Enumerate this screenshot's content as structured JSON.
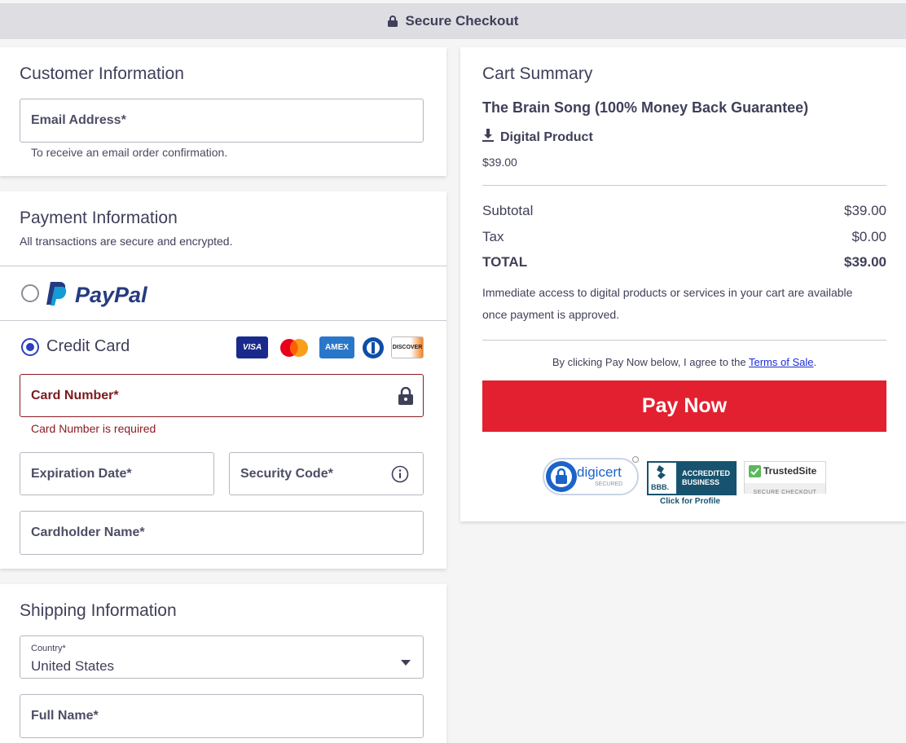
{
  "header": {
    "title": "Secure Checkout",
    "icon": "lock-icon"
  },
  "customer": {
    "title": "Customer Information",
    "email_label": "Email Address*",
    "email_hint": "To receive an email order confirmation."
  },
  "payment": {
    "title": "Payment Information",
    "subtitle": "All transactions are secure and encrypted.",
    "paypal_label": "PayPal",
    "credit_label": "Credit Card",
    "card_logos": [
      "VISA",
      "Mastercard",
      "AMEX",
      "Diners",
      "DISCOVER"
    ],
    "card_number_label": "Card Number*",
    "card_number_error": "Card Number is required",
    "expiration_label": "Expiration Date*",
    "security_label": "Security Code*",
    "cardholder_label": "Cardholder Name*",
    "selected_method": "credit-card"
  },
  "shipping": {
    "title": "Shipping Information",
    "country_label": "Country*",
    "country_value": "United States",
    "fullname_label": "Full Name*"
  },
  "cart": {
    "title": "Cart Summary",
    "product_name": "The Brain Song (100% Money Back Guarantee)",
    "product_type": "Digital Product",
    "product_price": "$39.00",
    "subtotal_label": "Subtotal",
    "subtotal_value": "$39.00",
    "tax_label": "Tax",
    "tax_value": "$0.00",
    "total_label": "TOTAL",
    "total_value": "$39.00",
    "access_note": "Immediate access to digital products or services in your cart are available once payment is approved.",
    "agree_prefix": "By clicking Pay Now below, I agree to the",
    "terms_link": "Terms of Sale",
    "agree_suffix": ".",
    "pay_button": "Pay Now"
  },
  "badges": {
    "digicert": "digicert",
    "digicert_sub": "SECURED",
    "bbb_line1": "ACCREDITED",
    "bbb_line2": "BUSINESS",
    "bbb_mark": "BBB.",
    "bbb_link": "Click for Profile",
    "trusted_name": "TrustedSite",
    "trusted_sub": "SECURE CHECKOUT"
  },
  "colors": {
    "accent": "#2b3fbf",
    "pay_button": "#e3202f",
    "error": "#8a1c22"
  }
}
